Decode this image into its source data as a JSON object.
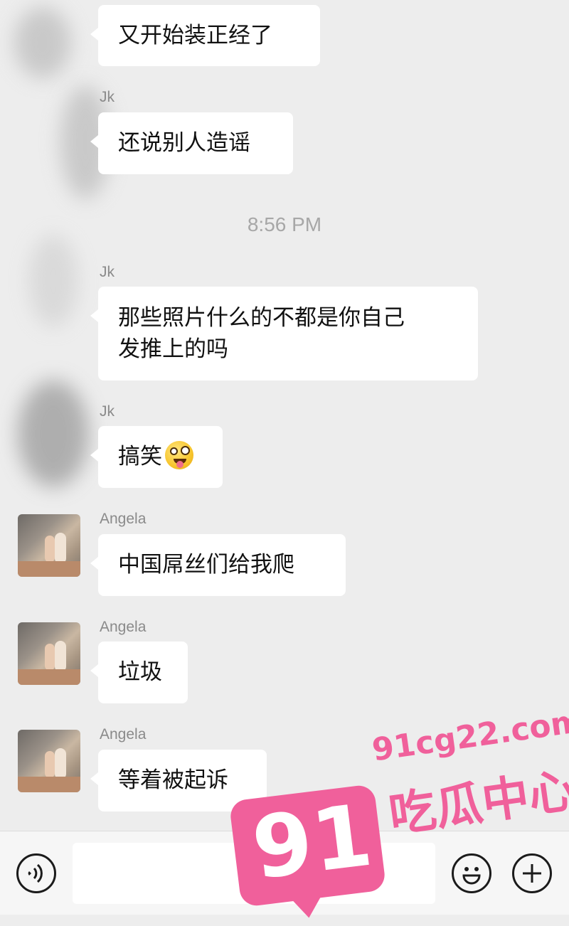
{
  "messages": [
    {
      "sender": "",
      "text": "又开始装正经了"
    },
    {
      "sender": "Jk",
      "text": "还说别人造谣"
    },
    {
      "sender": "Jk",
      "line1": "那些照片什么的不都是你自己",
      "line2": "发推上的吗"
    },
    {
      "sender": "Jk",
      "text": "搞笑",
      "emoji": "zany-face-emoji"
    },
    {
      "sender": "Angela",
      "text": "中国屌丝们给我爬"
    },
    {
      "sender": "Angela",
      "text": "垃圾"
    },
    {
      "sender": "Angela",
      "text": "等着被起诉"
    }
  ],
  "timestamp": "8:56 PM",
  "input_bar": {
    "voice_icon": "voice-icon",
    "emoji_icon": "smile-icon",
    "more_icon": "plus-icon",
    "placeholder": ""
  },
  "watermark": {
    "domain": "91cg22.com",
    "number": "91",
    "name": "吃瓜中心",
    "color": "#f0609b"
  }
}
